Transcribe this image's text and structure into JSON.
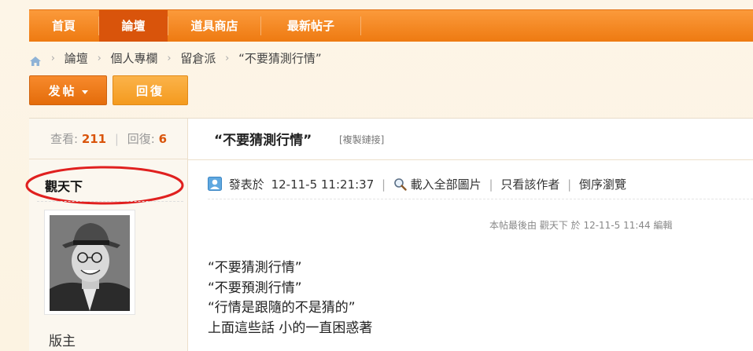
{
  "nav": {
    "items": [
      {
        "label": "首頁",
        "active": false
      },
      {
        "label": "論壇",
        "active": true
      },
      {
        "label": "道具商店",
        "active": false
      },
      {
        "label": "最新帖子",
        "active": false
      }
    ]
  },
  "breadcrumb": {
    "home_icon": "home-icon",
    "items": [
      "論壇",
      "個人專欄",
      "留倉派",
      "“不要猜測行情”"
    ]
  },
  "actions": {
    "post_label": "发帖",
    "reply_label": "回復"
  },
  "stats": {
    "views_label": "查看:",
    "views": "211",
    "replies_label": "回復:",
    "replies": "6"
  },
  "thread": {
    "title": "“不要猜測行情”",
    "copy_link": "[複製鏈接]"
  },
  "author": {
    "name": "觀天下",
    "role": "版主"
  },
  "post": {
    "posted_label": "發表於",
    "posted_time": "12-11-5 11:21:37",
    "load_images": "載入全部圖片",
    "only_author": "只看該作者",
    "reverse_order": "倒序瀏覽",
    "edit_note": "本帖最後由 觀天下 於 12-11-5 11:44 編輯",
    "lines": [
      "“不要猜測行情”",
      "“不要預測行情”",
      "“行情是跟隨的不是猜的”",
      "上面這些話  小的一直困惑著"
    ]
  },
  "colors": {
    "nav_orange": "#ee7a11",
    "nav_active": "#d9540b",
    "accent_number": "#d9540b",
    "annotation_red": "#e0201f"
  }
}
